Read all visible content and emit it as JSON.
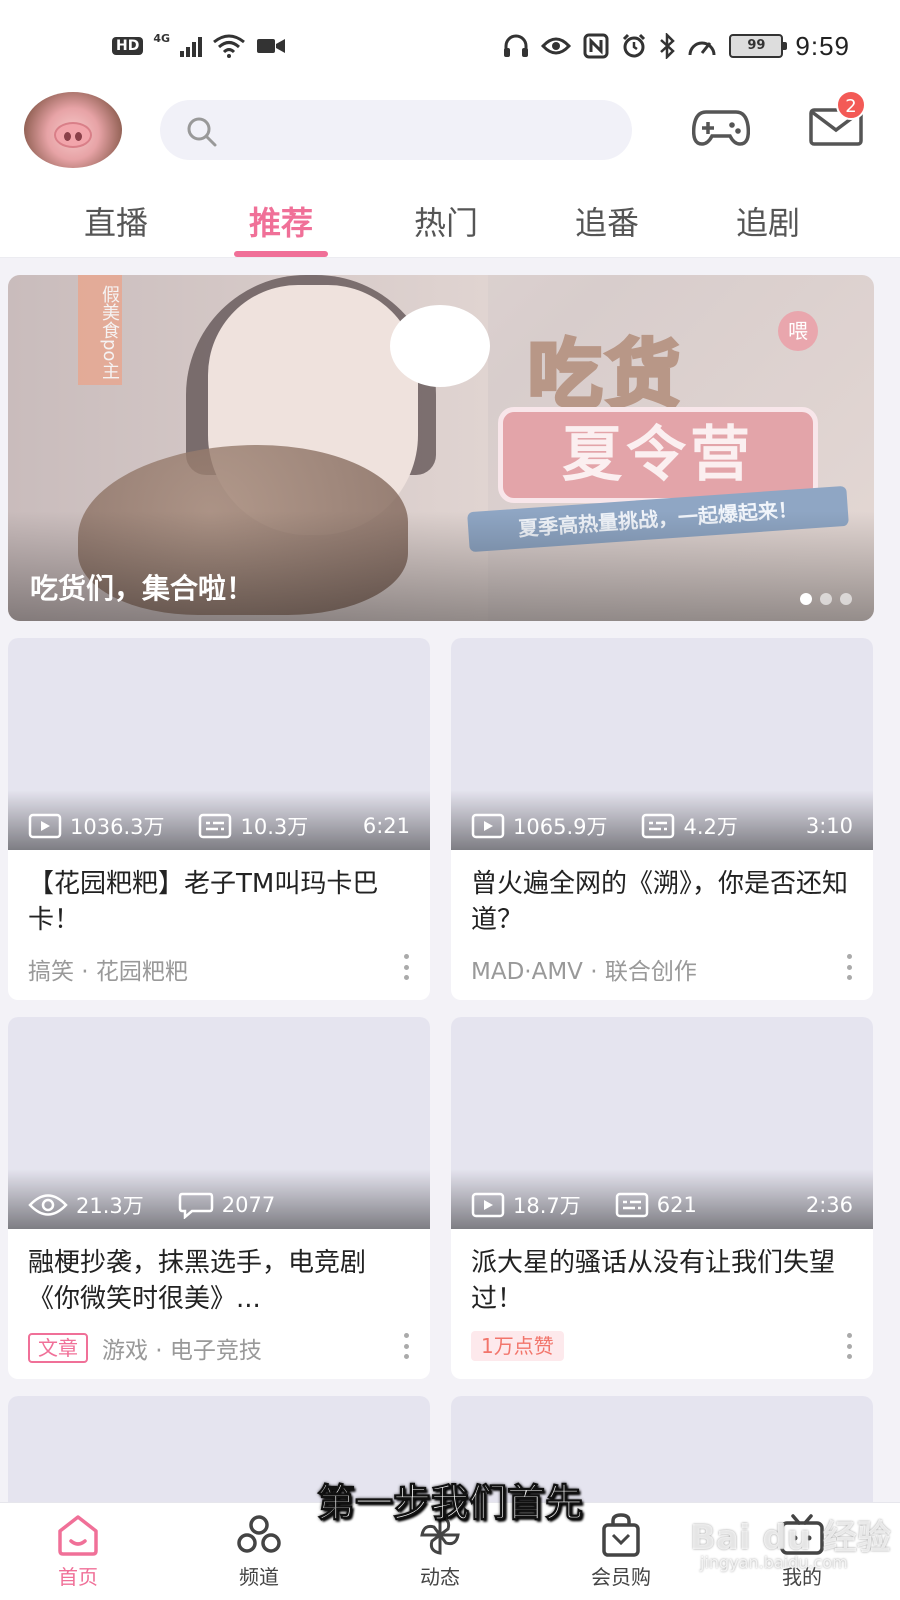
{
  "status_bar": {
    "hd": "HD",
    "network": "4G",
    "battery": "99",
    "time": "9:59"
  },
  "header": {
    "messages_badge": "2"
  },
  "tabs": [
    {
      "label": "直播"
    },
    {
      "label": "推荐",
      "active": true
    },
    {
      "label": "热门"
    },
    {
      "label": "追番"
    },
    {
      "label": "追剧"
    }
  ],
  "banner": {
    "title": "吃货们，集合啦！",
    "art_tag": "假美食po主",
    "art_logo_top": "吃货",
    "art_logo_badge": "喂",
    "art_logo_main": "夏令营",
    "art_logo_ribbon": "夏季高热量挑战，一起爆起来！",
    "dots": 3,
    "active_dot": 0
  },
  "cards": [
    {
      "views": "1036.3万",
      "comments": "10.3万",
      "duration": "6:21",
      "title": "【花园粑粑】老子TM叫玛卡巴卡！",
      "meta": "搞笑 · 花园粑粑"
    },
    {
      "views": "1065.9万",
      "comments": "4.2万",
      "duration": "3:10",
      "title": "曾火遍全网的《溯》，你是否还知道？",
      "meta": "MAD·AMV · 联合创作"
    },
    {
      "views": "21.3万",
      "comments": "2077",
      "title": "融梗抄袭，抹黑选手，电竞剧《你微笑时很美》...",
      "tag": "文章",
      "meta": "游戏 · 电子竞技"
    },
    {
      "views": "18.7万",
      "comments": "621",
      "duration": "2:36",
      "title": "派大星的骚话从没有让我们失望过！",
      "tag": "1万点赞"
    }
  ],
  "subtitle": "第一步我们首先",
  "bottom_nav": [
    {
      "label": "首页",
      "icon": "home-icon",
      "active": true
    },
    {
      "label": "频道",
      "icon": "channel-icon"
    },
    {
      "label": "动态",
      "icon": "pinwheel-icon"
    },
    {
      "label": "会员购",
      "icon": "shopping-bag-icon"
    },
    {
      "label": "我的",
      "icon": "tv-icon"
    }
  ],
  "watermark": {
    "text": "Bai du 经验",
    "url": "jingyan.baidu.com"
  },
  "colors": {
    "accent": "#f07098",
    "badge": "#f35a56",
    "background": "#f3f2f7"
  }
}
